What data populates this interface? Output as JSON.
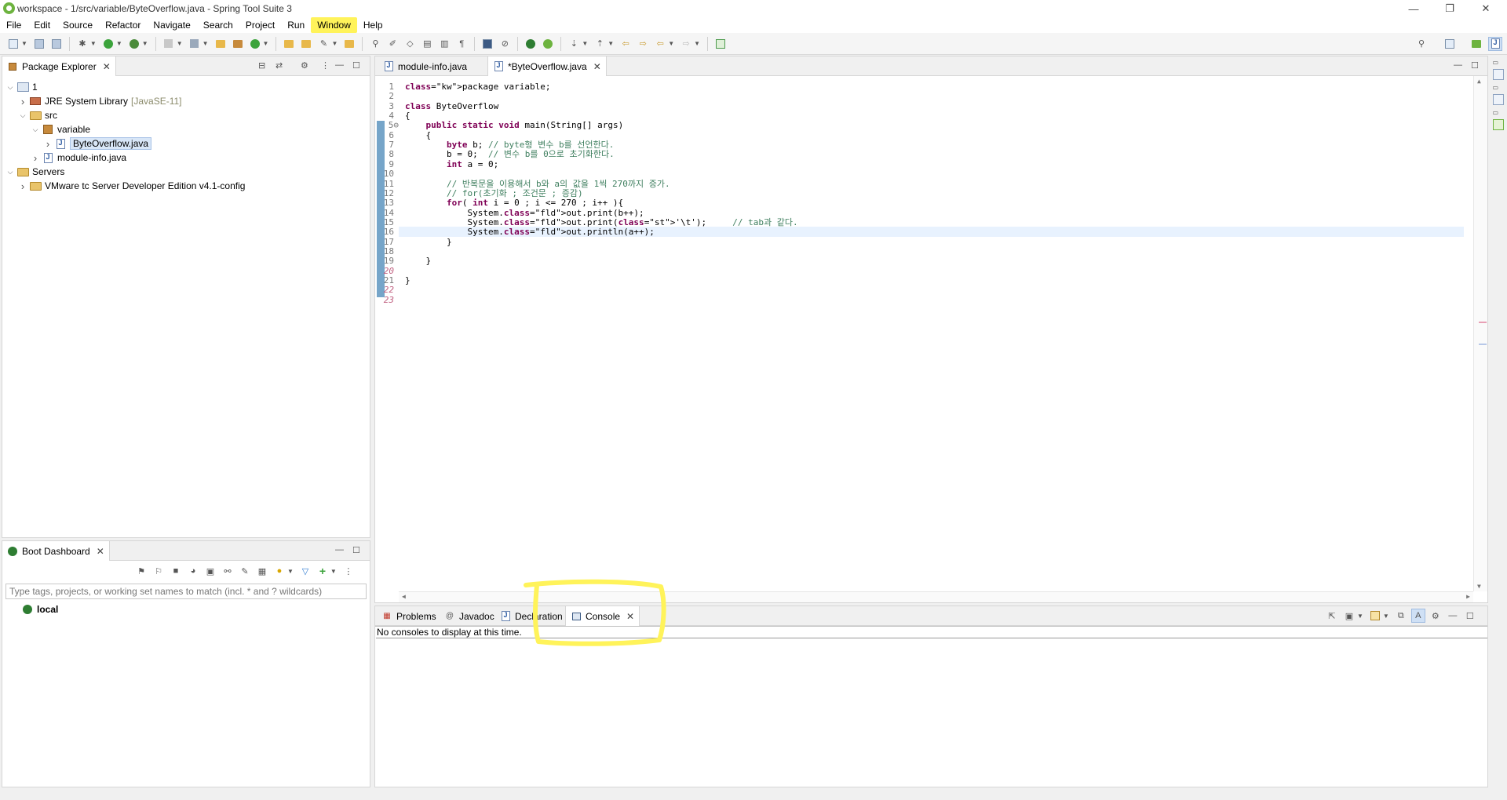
{
  "window": {
    "title": "workspace - 1/src/variable/ByteOverflow.java - Spring Tool Suite 3",
    "minimize": "—",
    "restore": "❐",
    "close": "✕"
  },
  "menu": [
    "File",
    "Edit",
    "Source",
    "Refactor",
    "Navigate",
    "Search",
    "Project",
    "Run",
    "Window",
    "Help"
  ],
  "highlighted_menu": "Window",
  "package_explorer": {
    "title": "Package Explorer",
    "tree": [
      {
        "label": "1",
        "level": 0,
        "twist": "open",
        "icon": "proj"
      },
      {
        "label": "JRE System Library",
        "suffix": "[JavaSE-11]",
        "level": 1,
        "twist": "closed",
        "icon": "lib"
      },
      {
        "label": "src",
        "level": 1,
        "twist": "open",
        "icon": "folder"
      },
      {
        "label": "variable",
        "level": 2,
        "twist": "open",
        "icon": "pkg"
      },
      {
        "label": "ByteOverflow.java",
        "level": 3,
        "twist": "closed",
        "icon": "jfile",
        "selected": true
      },
      {
        "label": "module-info.java",
        "level": 2,
        "twist": "closed",
        "icon": "jfile"
      },
      {
        "label": "Servers",
        "level": 0,
        "twist": "open",
        "icon": "folder"
      },
      {
        "label": "VMware tc Server Developer Edition v4.1-config",
        "level": 1,
        "twist": "closed",
        "icon": "folder"
      }
    ]
  },
  "boot_dashboard": {
    "title": "Boot Dashboard",
    "filter_placeholder": "Type tags, projects, or working set names to match (incl. * and ? wildcards)",
    "items": [
      "local"
    ]
  },
  "editor": {
    "tabs": [
      {
        "label": "module-info.java",
        "active": false
      },
      {
        "label": "*ByteOverflow.java",
        "active": true
      }
    ],
    "current_line": 16,
    "lines": [
      "package variable;",
      "",
      "class ByteOverflow",
      "{",
      "    public static void main(String[] args)",
      "    {",
      "        byte b; // byte형 변수 b를 선언한다.",
      "        b = 0;  // 변수 b를 0으로 초기화한다.",
      "        int a = 0;",
      "",
      "        // 반복문을 이용해서 b와 a의 값을 1씩 270까지 증가.",
      "        // for(초기화 ; 조건문 ; 증감)",
      "        for( int i = 0 ; i <= 270 ; i++ ){",
      "            System.out.print(b++);",
      "            System.out.print('\\t');     // tab과 같다.",
      "            System.out.println(a++);",
      "        }",
      "",
      "    }",
      "",
      "}",
      "",
      ""
    ]
  },
  "bottom_panel": {
    "tabs": [
      {
        "label": "Problems",
        "active": false
      },
      {
        "label": "Javadoc",
        "active": false
      },
      {
        "label": "Declaration",
        "active": false
      },
      {
        "label": "Console",
        "active": true
      }
    ],
    "console_message": "No consoles to display at this time."
  },
  "colors": {
    "annotation": "#fff35a",
    "keyword": "#7f0055",
    "comment": "#3f7f5f",
    "string": "#2a00ff",
    "field": "#0000c0"
  }
}
